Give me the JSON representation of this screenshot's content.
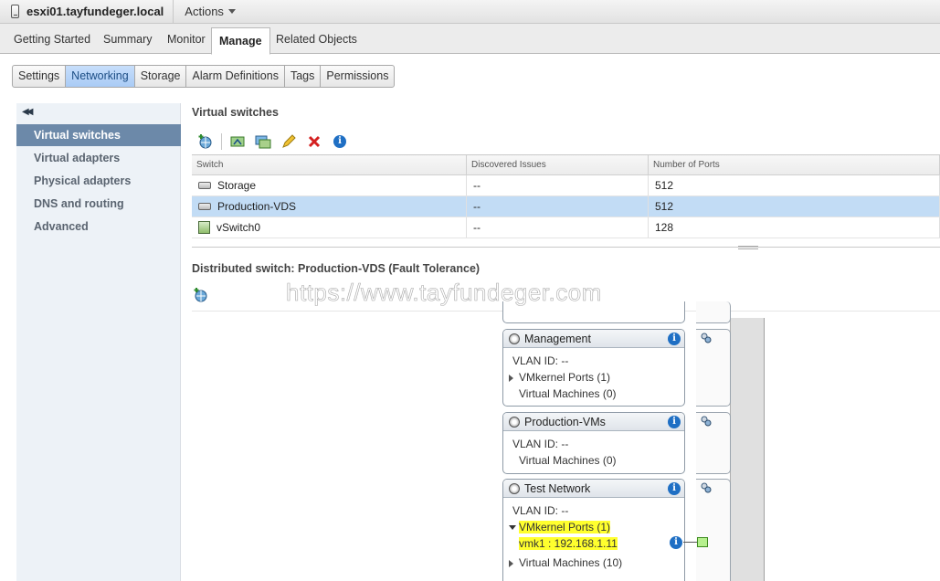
{
  "header": {
    "host_name": "esxi01.tayfundeger.local",
    "actions_label": "Actions"
  },
  "main_tabs": [
    {
      "label": "Getting Started"
    },
    {
      "label": "Summary"
    },
    {
      "label": "Monitor"
    },
    {
      "label": "Manage",
      "active": true
    },
    {
      "label": "Related Objects"
    }
  ],
  "sub_tabs": [
    {
      "label": "Settings"
    },
    {
      "label": "Networking",
      "active": true
    },
    {
      "label": "Storage"
    },
    {
      "label": "Alarm Definitions"
    },
    {
      "label": "Tags"
    },
    {
      "label": "Permissions"
    }
  ],
  "sidebar": {
    "collapse_glyph": "◀◀",
    "items": [
      {
        "label": "Virtual switches",
        "active": true
      },
      {
        "label": "Virtual adapters"
      },
      {
        "label": "Physical adapters"
      },
      {
        "label": "DNS and routing"
      },
      {
        "label": "Advanced"
      }
    ]
  },
  "switches_panel": {
    "title": "Virtual switches",
    "columns": [
      "Switch",
      "Discovered Issues",
      "Number of Ports"
    ],
    "rows": [
      {
        "switch": "Storage",
        "issues": "--",
        "ports": "512"
      },
      {
        "switch": "Production-VDS",
        "issues": "--",
        "ports": "512",
        "selected": true
      },
      {
        "switch": "vSwitch0",
        "issues": "--",
        "ports": "128"
      }
    ]
  },
  "detail_panel": {
    "title": "Distributed switch: Production-VDS (Fault Tolerance)",
    "watermark": "https://www.tayfundeger.com"
  },
  "port_groups": [
    {
      "name": "Management",
      "vlan": "VLAN ID: --",
      "vmkernel": "VMkernel Ports (1)",
      "vms": "Virtual Machines (0)"
    },
    {
      "name": "Production-VMs",
      "vlan": "VLAN ID: --",
      "vms": "Virtual Machines (0)"
    },
    {
      "name": "Test Network",
      "vlan": "VLAN ID: --",
      "vmkernel": "VMkernel Ports (1)",
      "vmk": "vmk1 : 192.168.1.11",
      "vms": "Virtual Machines (10)"
    }
  ],
  "colors": {
    "selected_row": "#c2dcf5",
    "nav_active": "#6c89a9",
    "subtab_active": "#a9cbf5",
    "highlight": "#ffff2e",
    "info_icon": "#1f6fc4"
  }
}
